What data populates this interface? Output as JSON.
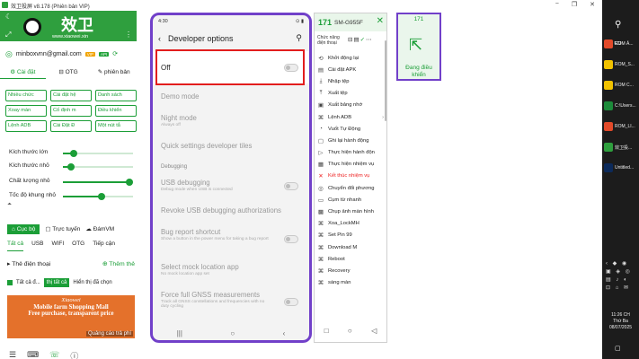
{
  "window": {
    "title": "效卫投屏 v8.178 (Phiên bản VIP)",
    "controls": [
      "−",
      "❐",
      "✕"
    ]
  },
  "left": {
    "logo_text": "效卫",
    "logo_url": "www.xiaowei.xin",
    "email": "minboxvnn@gmail.com",
    "badge_vip": "VIP",
    "badge_api": "API",
    "tabs": [
      "Cài đặt",
      "OTG",
      "phiên bản"
    ],
    "chips": [
      "Nhiều chức",
      "Cài đặt hệ",
      "Danh sách",
      "Xoay màn",
      "Cố định m",
      "Điều khiển",
      "Lệnh ADB",
      "Cài Đặt Đ",
      "Một nút tắ"
    ],
    "sliders": [
      {
        "label": "Kích thước lớn",
        "value": 0.15
      },
      {
        "label": "Kích thước nhỏ",
        "value": 0.12
      },
      {
        "label": "Chất lượng nhỏ",
        "value": 0.95
      },
      {
        "label": "Tốc độ khung nhỏ",
        "value": 0.55
      }
    ],
    "modes": [
      "Cục bộ",
      "Trực tuyến",
      "ĐámVM"
    ],
    "filter_tabs": [
      "Tất cả",
      "USB",
      "WIFI",
      "OTG",
      "Tiếp cận"
    ],
    "device_list_label": "Thẻ điện thoại",
    "add_label": "Thêm thẻ",
    "select_all_label": "Tất cả đ...",
    "select_button": "thị tất cả",
    "show_selected": "Hiển thị đã chọn",
    "ad": {
      "line1": "Xiaowei",
      "line2": "Mobile farm Shopping Mall",
      "line3": "Free purchase, transparent price",
      "tag": "Quảng cáo trả phí"
    }
  },
  "phone": {
    "time": "4:30",
    "status_right": "⊙ ▮",
    "title": "Developer options",
    "off_label": "Off",
    "settings": [
      {
        "main": "Demo mode",
        "sub": ""
      },
      {
        "main": "Night mode",
        "sub": "Always off"
      },
      {
        "main": "Quick settings developer tiles",
        "sub": ""
      }
    ],
    "section": "Debugging",
    "debug_settings": [
      {
        "main": "USB debugging",
        "sub": "Debug mode when USB is connected"
      },
      {
        "main": "Revoke USB debugging authorizations",
        "sub": ""
      },
      {
        "main": "Bug report shortcut",
        "sub": "Show a button in the power menu for taking a bug report"
      },
      {
        "main": "Select mock location app",
        "sub": "No mock location app set"
      },
      {
        "main": "Force full GNSS measurements",
        "sub": "Track all GNSS constellations and frequencies with no duty cycling"
      }
    ]
  },
  "tools": {
    "number": "171",
    "model": "SM-G955F",
    "subtitle_line1": "Chức năng",
    "subtitle_line2": "điện thoại",
    "items": [
      {
        "icon": "⟲",
        "label": "Khởi động lại",
        "red": false
      },
      {
        "icon": "▤",
        "label": "Cài đặt APK",
        "red": false
      },
      {
        "icon": "⤓",
        "label": "Nhập tệp",
        "red": false
      },
      {
        "icon": "⤒",
        "label": "Xuất tệp",
        "red": false
      },
      {
        "icon": "▣",
        "label": "Xuất bảng nhớ",
        "red": false
      },
      {
        "icon": "⌘",
        "label": "Lệnh ADB",
        "red": false
      },
      {
        "icon": "◔",
        "label": "Vuốt Tự Động",
        "red": false
      },
      {
        "icon": "▢",
        "label": "Ghi lại hành động",
        "red": false
      },
      {
        "icon": "▷",
        "label": "Thực hiện hành độn",
        "red": false
      },
      {
        "icon": "▦",
        "label": "Thực hiện nhiệm vụ",
        "red": false
      },
      {
        "icon": "✕",
        "label": "Kết thúc nhiệm vụ",
        "red": true
      },
      {
        "icon": "◎",
        "label": "Chuyển đổi phương",
        "red": false
      },
      {
        "icon": "▭",
        "label": "Cụm từ nhanh",
        "red": false
      },
      {
        "icon": "▩",
        "label": "Chụp ảnh màn hình",
        "red": false
      },
      {
        "icon": "⌘",
        "label": "Xoa_LockMH",
        "red": false
      },
      {
        "icon": "⌘",
        "label": "Set Pin 99",
        "red": false
      },
      {
        "icon": "⌘",
        "label": "Download M",
        "red": false
      },
      {
        "icon": "⌘",
        "label": "Reboot",
        "red": false
      },
      {
        "icon": "⌘",
        "label": "Recovery",
        "red": false
      },
      {
        "icon": "⌘",
        "label": "sáng màn",
        "red": false
      }
    ]
  },
  "mini": {
    "number": "171",
    "status_line1": "Đang điều",
    "status_line2": "khiển"
  },
  "taskbar": {
    "apps": [
      {
        "label": "ROM Ả...",
        "color": "#e24a2a"
      },
      {
        "label": "ROM_S...",
        "color": "#f2c200"
      },
      {
        "label": "ROM C...",
        "color": "#f2c200"
      },
      {
        "label": "C:\\Users...",
        "color": "#1c8a3a"
      },
      {
        "label": "ROM_LI...",
        "color": "#e24a2a"
      },
      {
        "label": "效卫投...",
        "color": "#2f9f3e"
      },
      {
        "label": "Untitled...",
        "color": "#0c2a5a"
      }
    ],
    "time": "11:26 CH",
    "day": "Thứ Ba",
    "date": "08/07/2025"
  }
}
